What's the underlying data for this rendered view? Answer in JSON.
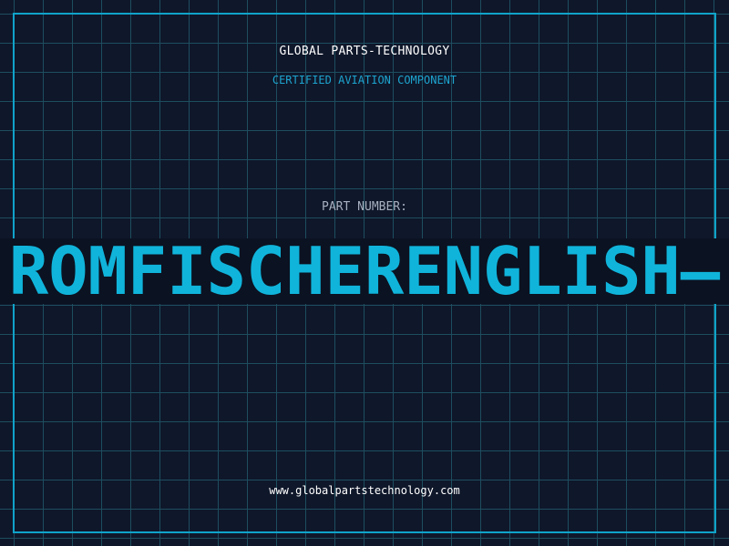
{
  "header": {
    "company_name": "GLOBAL PARTS-TECHNOLOGY",
    "subtitle": "CERTIFIED AVIATION COMPONENT"
  },
  "part": {
    "label": "PART NUMBER:",
    "number": "ROMFISCHERENGLISH—"
  },
  "footer": {
    "website": "www.globalpartstechnology.com"
  },
  "colors": {
    "background": "#0f172a",
    "grid": "#1d4e5f",
    "accent": "#10b4db",
    "frame": "#10a3c9"
  }
}
